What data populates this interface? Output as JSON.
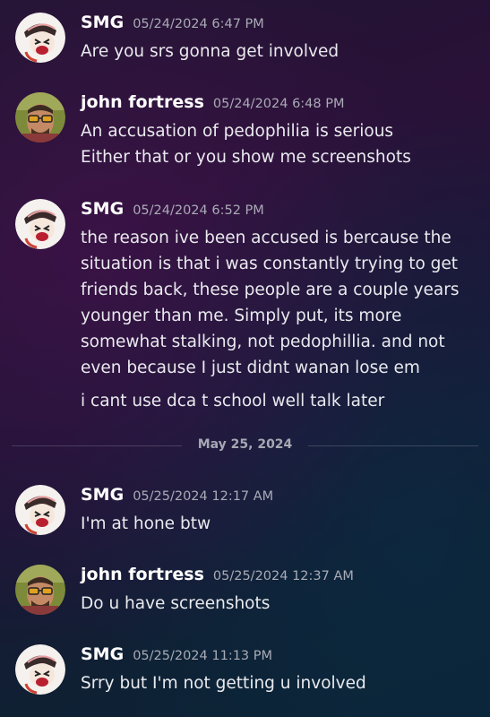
{
  "messages": [
    {
      "author": "SMG",
      "timestamp": "05/24/2024 6:47 PM",
      "avatar_icon": "smg-avatar-icon",
      "lines": [
        "Are you srs gonna get involved"
      ]
    },
    {
      "author": "john fortress",
      "timestamp": "05/24/2024 6:48 PM",
      "avatar_icon": "john-fortress-avatar-icon",
      "lines": [
        "An accusation of pedophilia is serious",
        "Either that or you show me screenshots"
      ]
    },
    {
      "author": "SMG",
      "timestamp": "05/24/2024 6:52 PM",
      "avatar_icon": "smg-avatar-icon",
      "lines": [
        "the reason ive been accused is bercause the",
        "situation is that i was constantly trying to get",
        "friends back, these people are a couple years",
        "younger than me. Simply put, its more",
        "somewhat stalking, not pedophillia. and not",
        "even because I just didnt wanan lose em",
        "i cant use dca t school well talk later"
      ]
    },
    {
      "author": "SMG",
      "timestamp": "05/25/2024 12:17 AM",
      "avatar_icon": "smg-avatar-icon",
      "lines": [
        "I'm at hone btw"
      ]
    },
    {
      "author": "john fortress",
      "timestamp": "05/25/2024 12:37 AM",
      "avatar_icon": "john-fortress-avatar-icon",
      "lines": [
        "Do u have screenshots"
      ]
    },
    {
      "author": "SMG",
      "timestamp": "05/25/2024 11:13 PM",
      "avatar_icon": "smg-avatar-icon",
      "lines": [
        "Srry but I'm not getting u involved"
      ]
    }
  ],
  "date_divider": "May 25, 2024",
  "colors": {
    "author": "#ffffff",
    "timestamp": "#a9abb6",
    "message_text": "#e9eaee",
    "divider_text": "#a6a8b3"
  }
}
